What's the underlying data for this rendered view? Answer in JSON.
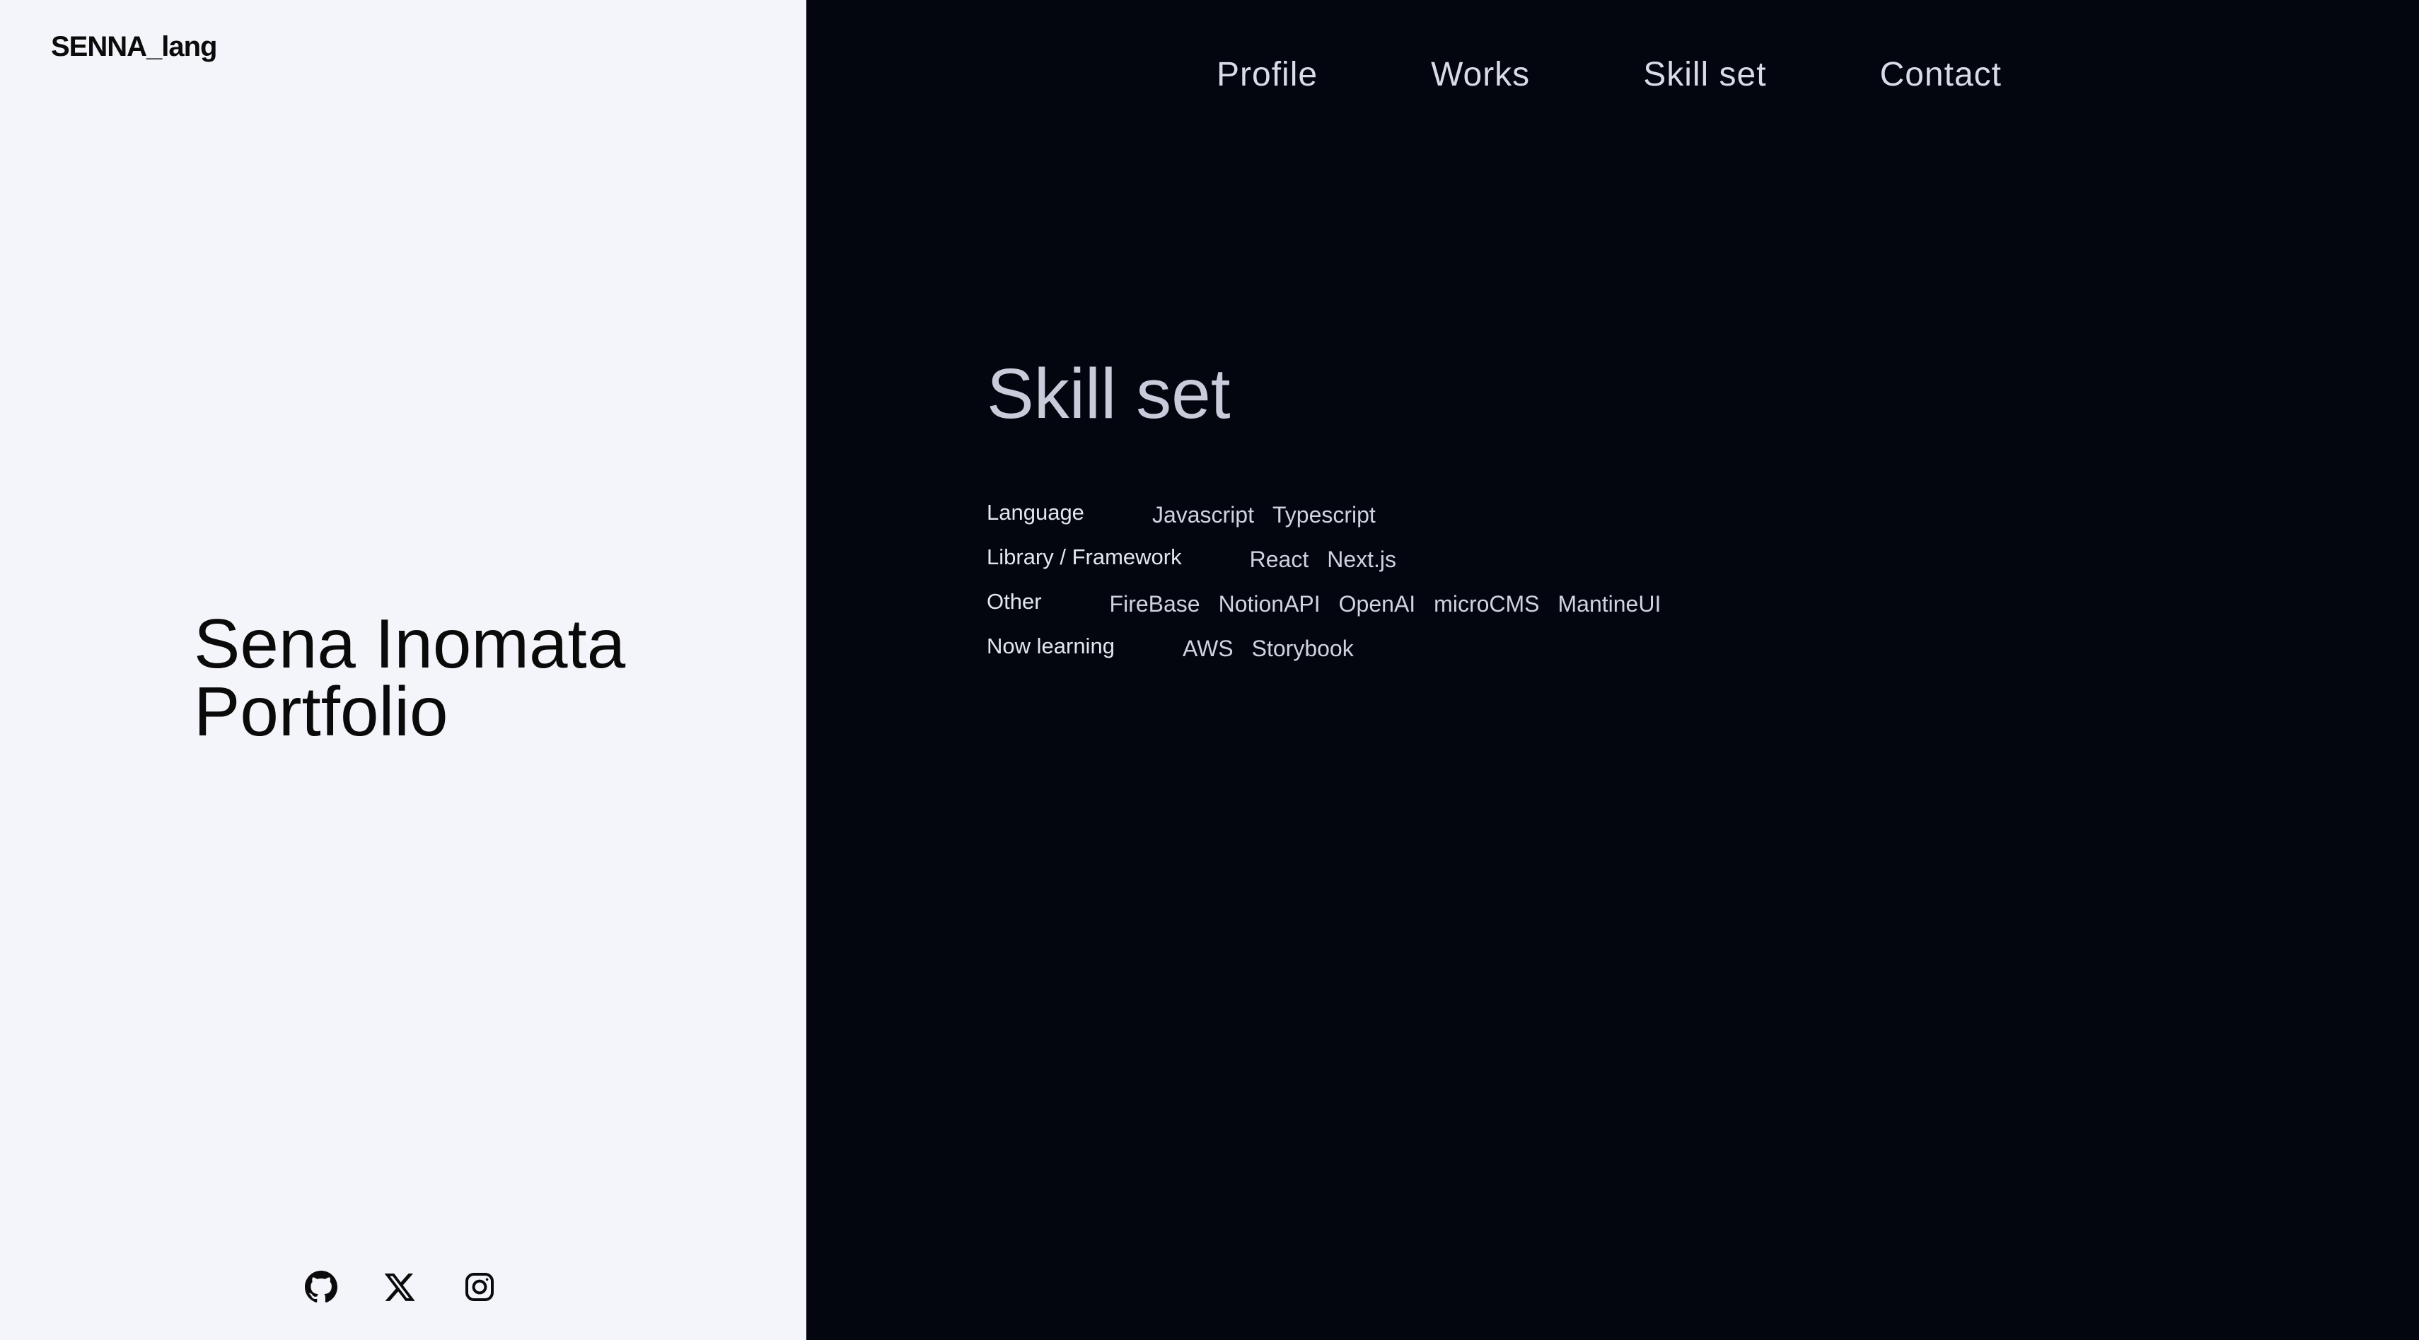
{
  "site": {
    "logo": "SENNA_lang"
  },
  "hero": {
    "line1": "Sena Inomata",
    "line2": "Portfolio"
  },
  "social": [
    "github-icon",
    "x-icon",
    "instagram-icon"
  ],
  "nav": {
    "items": [
      "Profile",
      "Works",
      "Skill set",
      "Contact"
    ]
  },
  "skillset": {
    "title": "Skill set",
    "rows": [
      {
        "category": "Language",
        "tags": [
          "Javascript",
          "Typescript"
        ]
      },
      {
        "category": "Library / Framework",
        "tags": [
          "React",
          "Next.js"
        ]
      },
      {
        "category": "Other",
        "tags": [
          "FireBase",
          "NotionAPI",
          "OpenAI",
          "microCMS",
          "MantineUI"
        ]
      },
      {
        "category": "Now learning",
        "tags": [
          "AWS",
          "Storybook"
        ]
      }
    ]
  },
  "colors": {
    "left_bg": "#f4f5fa",
    "right_bg": "#03060f",
    "text_dark": "#0a0a0a",
    "text_light": "#d9dbe6"
  }
}
